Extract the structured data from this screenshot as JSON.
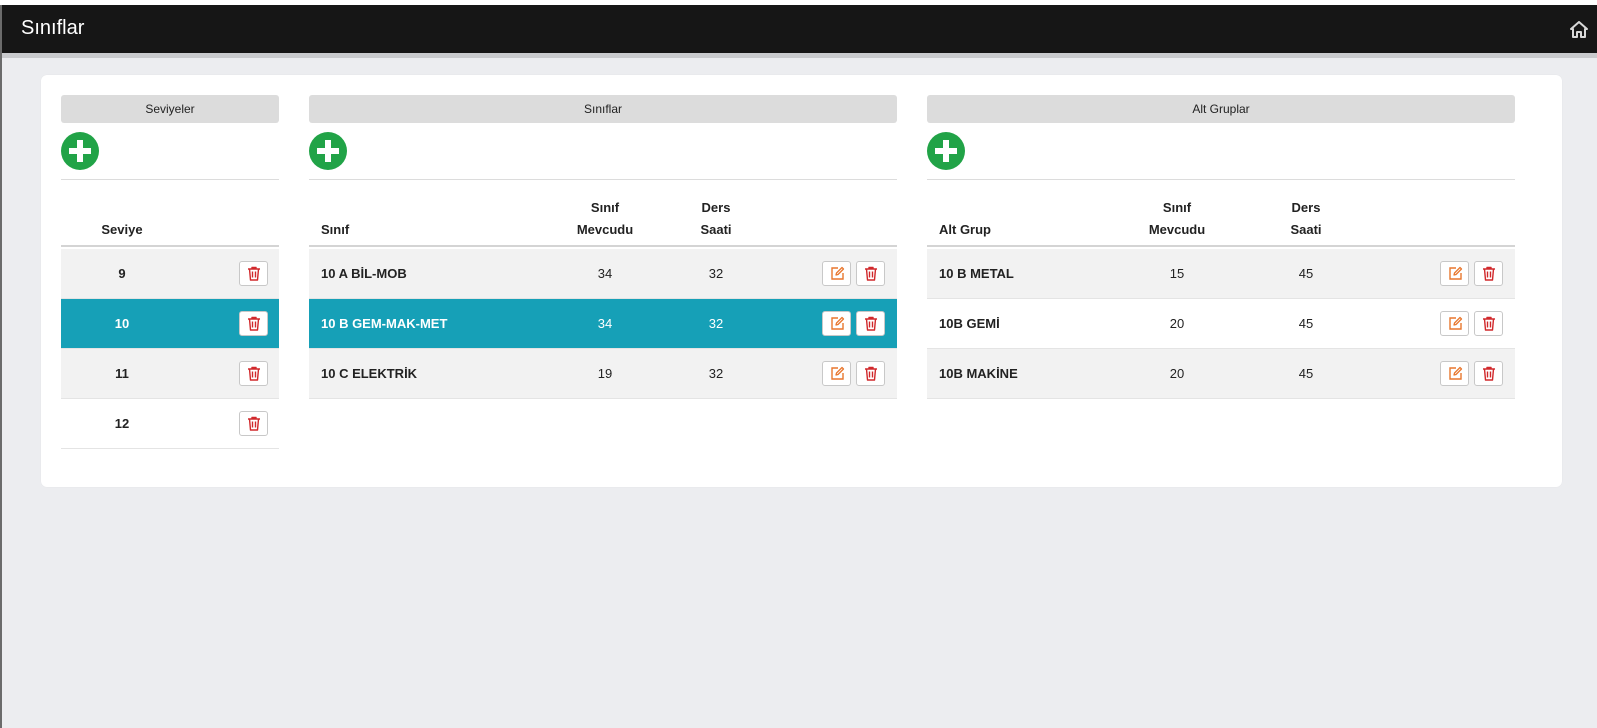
{
  "app": {
    "title": "Sınıflar"
  },
  "icons": {
    "home": "home-icon",
    "add": "plus-circle-icon",
    "edit": "edit-icon",
    "delete": "trash-icon"
  },
  "colors": {
    "topbar": "#161616",
    "selected_row": "#16a0b7",
    "add_button": "#21a347",
    "edit_icon": "#e8772e",
    "delete_icon": "#d1282b"
  },
  "seviyeler": {
    "header": "Seviyeler",
    "columns": [
      "Seviye"
    ],
    "rows": [
      {
        "seviye": "9",
        "selected": false
      },
      {
        "seviye": "10",
        "selected": true
      },
      {
        "seviye": "11",
        "selected": false
      },
      {
        "seviye": "12",
        "selected": false
      }
    ]
  },
  "siniflar": {
    "header": "Sınıflar",
    "columns": {
      "sinif": "Sınıf",
      "mevcut_1": "Sınıf",
      "mevcut_2": "Mevcudu",
      "saat_1": "Ders",
      "saat_2": "Saati"
    },
    "rows": [
      {
        "ad": "10 A BİL-MOB",
        "mevcut": "34",
        "saat": "32",
        "selected": false
      },
      {
        "ad": "10 B GEM-MAK-MET",
        "mevcut": "34",
        "saat": "32",
        "selected": true
      },
      {
        "ad": "10 C ELEKTRİK",
        "mevcut": "19",
        "saat": "32",
        "selected": false
      }
    ]
  },
  "alt_gruplar": {
    "header": "Alt Gruplar",
    "columns": {
      "grup": "Alt Grup",
      "mevcut_1": "Sınıf",
      "mevcut_2": "Mevcudu",
      "saat_1": "Ders",
      "saat_2": "Saati"
    },
    "rows": [
      {
        "ad": "10 B METAL",
        "mevcut": "15",
        "saat": "45"
      },
      {
        "ad": "10B GEMİ",
        "mevcut": "20",
        "saat": "45"
      },
      {
        "ad": "10B MAKİNE",
        "mevcut": "20",
        "saat": "45"
      }
    ]
  }
}
